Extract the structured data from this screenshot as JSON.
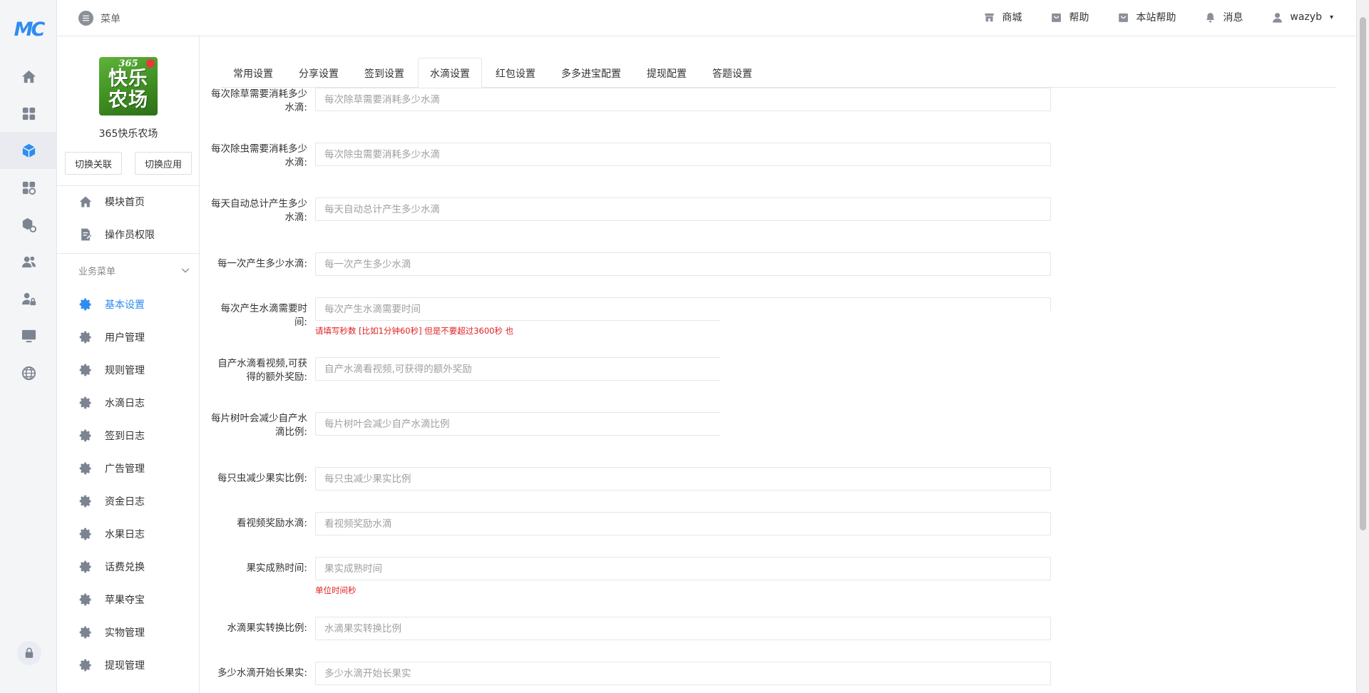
{
  "rail": {
    "logo": "MC",
    "icons": [
      "home-icon",
      "apps-grid-icon",
      "cube-icon",
      "apps-plus-icon",
      "package-settings-icon",
      "users-icon",
      "user-lock-icon",
      "monitor-icon",
      "globe-icon"
    ],
    "active_index": 2
  },
  "topbar": {
    "menu_label": "菜单",
    "links": [
      {
        "label": "商城",
        "icon": "store-icon"
      },
      {
        "label": "帮助",
        "icon": "bag-icon"
      },
      {
        "label": "本站帮助",
        "icon": "bag-icon"
      },
      {
        "label": "消息",
        "icon": "bell-icon"
      }
    ],
    "user": "wazyb",
    "caret": "▾"
  },
  "sidebar": {
    "app_logo": {
      "badge": "365",
      "line1": "快乐",
      "line2": "农场"
    },
    "app_name": "365快乐农场",
    "switch_relation": "切换关联",
    "switch_app": "切换应用",
    "top_items": [
      {
        "label": "模块首页",
        "icon": "home-icon"
      },
      {
        "label": "操作员权限",
        "icon": "doc-edit-icon"
      }
    ],
    "group_title": "业务菜单",
    "items": [
      {
        "label": "基本设置",
        "active": true
      },
      {
        "label": "用户管理"
      },
      {
        "label": "规则管理"
      },
      {
        "label": "水滴日志"
      },
      {
        "label": "签到日志"
      },
      {
        "label": "广告管理"
      },
      {
        "label": "资金日志"
      },
      {
        "label": "水果日志"
      },
      {
        "label": "话费兑换"
      },
      {
        "label": "苹果夺宝"
      },
      {
        "label": "实物管理"
      },
      {
        "label": "提现管理"
      }
    ]
  },
  "tabs": [
    "常用设置",
    "分享设置",
    "签到设置",
    "水滴设置",
    "红包设置",
    "多多进宝配置",
    "提现配置",
    "答题设置"
  ],
  "active_tab": 3,
  "form": [
    {
      "label": "每次除草需要消耗多少水滴:",
      "placeholder": "每次除草需要消耗多少水滴"
    },
    {
      "label": "每次除虫需要消耗多少水滴:",
      "placeholder": "每次除虫需要消耗多少水滴"
    },
    {
      "label": "每天自动总计产生多少水滴:",
      "placeholder": "每天自动总计产生多少水滴"
    },
    {
      "label": "每一次产生多少水滴:",
      "placeholder": "每一次产生多少水滴"
    },
    {
      "label": "每次产生水滴需要时间:",
      "placeholder": "每次产生水滴需要时间",
      "hint": "请填写秒数 [比如1分钟60秒] 但是不要超过3600秒 也"
    },
    {
      "label": "自产水滴看视频,可获得的额外奖励:",
      "placeholder": "自产水滴看视频,可获得的额外奖励"
    },
    {
      "label": "每片树叶会减少自产水滴比例:",
      "placeholder": "每片树叶会减少自产水滴比例"
    },
    {
      "label": "每只虫减少果实比例:",
      "placeholder": "每只虫减少果实比例"
    },
    {
      "label": "看视频奖励水滴:",
      "placeholder": "看视频奖励水滴"
    },
    {
      "label": "果实成熟时间:",
      "placeholder": "果实成熟时间",
      "hint": "单位时间秒"
    },
    {
      "label": "水滴果实转换比例:",
      "placeholder": "水滴果实转换比例"
    },
    {
      "label": "多少水滴开始长果实:",
      "placeholder": "多少水滴开始长果实"
    }
  ]
}
